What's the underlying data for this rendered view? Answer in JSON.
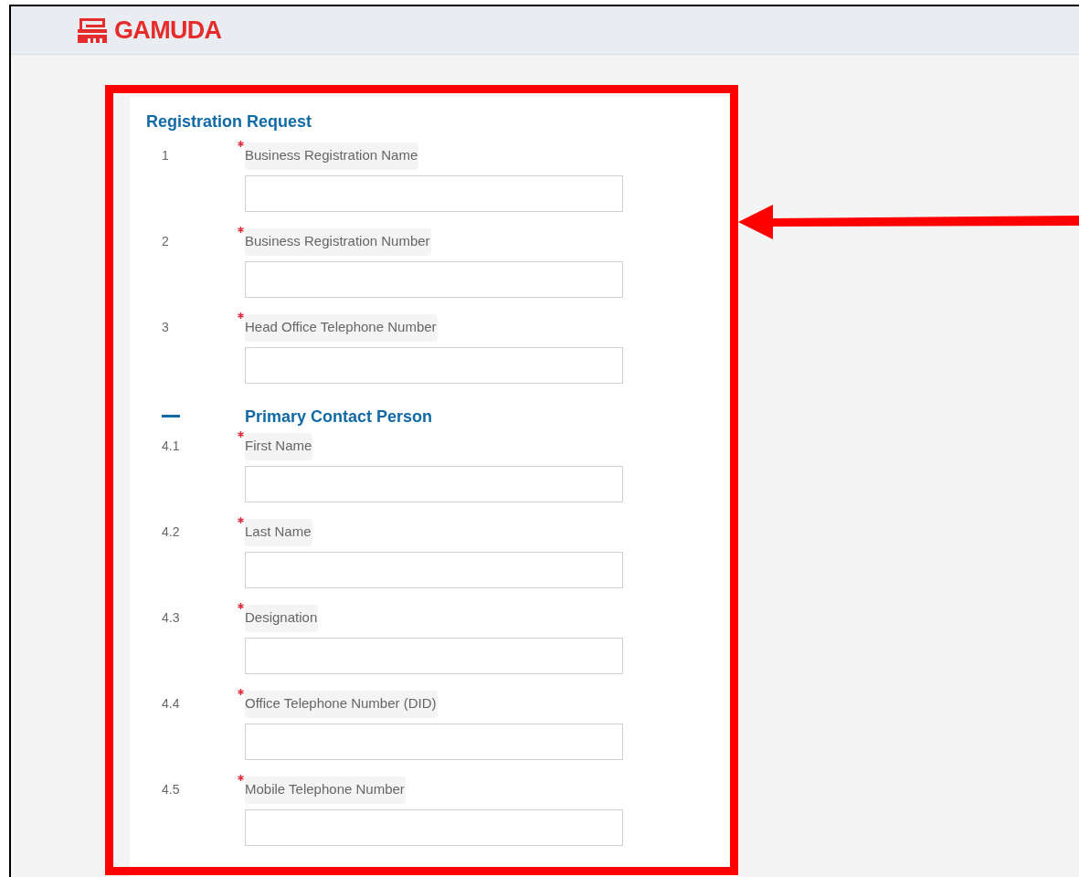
{
  "header": {
    "logo_text": "GAMUDA"
  },
  "form": {
    "title": "Registration Request",
    "fields": [
      {
        "number": "1",
        "label": "Business Registration Name",
        "required": true
      },
      {
        "number": "2",
        "label": "Business Registration Number",
        "required": true
      },
      {
        "number": "3",
        "label": "Head Office Telephone Number",
        "required": true
      }
    ],
    "sections": [
      {
        "title": "Primary Contact Person",
        "expanded": true,
        "fields": [
          {
            "number": "4.1",
            "label": "First Name",
            "required": true
          },
          {
            "number": "4.2",
            "label": "Last Name",
            "required": true
          },
          {
            "number": "4.3",
            "label": "Designation",
            "required": true
          },
          {
            "number": "4.4",
            "label": "Office Telephone Number (DID)",
            "required": true
          },
          {
            "number": "4.5",
            "label": "Mobile Telephone Number",
            "required": true
          }
        ]
      }
    ]
  }
}
